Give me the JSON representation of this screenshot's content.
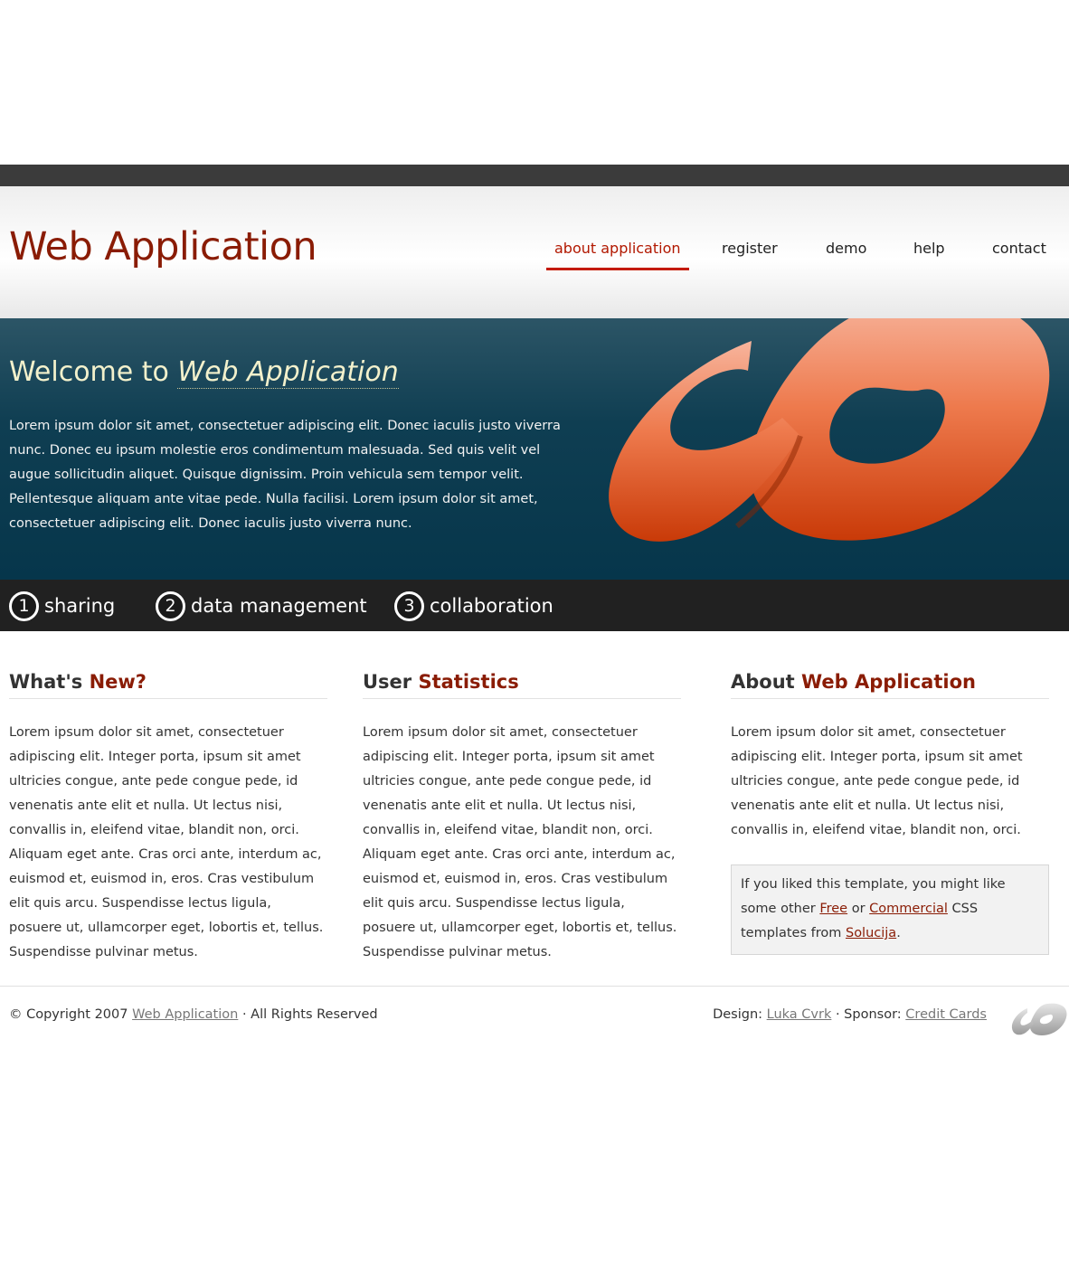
{
  "header": {
    "site_title": "Web Application",
    "nav": [
      {
        "label": "about application",
        "active": true
      },
      {
        "label": "register",
        "active": false
      },
      {
        "label": "demo",
        "active": false
      },
      {
        "label": "help",
        "active": false
      },
      {
        "label": "contact",
        "active": false
      }
    ]
  },
  "hero": {
    "title_prefix": "Welcome to ",
    "title_emphasis": "Web Application",
    "text": "Lorem ipsum dolor sit amet, consectetuer adipiscing elit. Donec iaculis justo viverra nunc. Donec eu ipsum molestie eros condimentum malesuada. Sed quis velit vel augue sollicitudin aliquet. Quisque dignissim. Proin vehicula sem tempor velit. Pellentesque aliquam ante vitae pede. Nulla facilisi. Lorem ipsum dolor sit amet, consectetuer adipiscing elit. Donec iaculis justo viverra nunc."
  },
  "features": [
    {
      "number": "1",
      "label": "sharing"
    },
    {
      "number": "2",
      "label": "data management"
    },
    {
      "number": "3",
      "label": "collaboration"
    }
  ],
  "columns": [
    {
      "title_plain": "What's ",
      "title_accent": "New?",
      "text": "Lorem ipsum dolor sit amet, consectetuer adipiscing elit. Integer porta, ipsum sit amet ultricies congue, ante pede congue pede, id venenatis ante elit et nulla. Ut lectus nisi, convallis in, eleifend vitae, blandit non, orci. Aliquam eget ante. Cras orci ante, interdum ac, euismod et, euismod in, eros. Cras vestibulum elit quis arcu. Suspendisse lectus ligula, posuere ut, ullamcorper eget, lobortis et, tellus. Suspendisse pulvinar metus."
    },
    {
      "title_plain": "User ",
      "title_accent": "Statistics",
      "text": "Lorem ipsum dolor sit amet, consectetuer adipiscing elit. Integer porta, ipsum sit amet ultricies congue, ante pede congue pede, id venenatis ante elit et nulla. Ut lectus nisi, convallis in, eleifend vitae, blandit non, orci. Aliquam eget ante. Cras orci ante, interdum ac, euismod et, euismod in, eros. Cras vestibulum elit quis arcu. Suspendisse lectus ligula, posuere ut, ullamcorper eget, lobortis et, tellus. Suspendisse pulvinar metus."
    },
    {
      "title_plain": "About ",
      "title_accent": "Web Application",
      "text": "Lorem ipsum dolor sit amet, consectetuer adipiscing elit. Integer porta, ipsum sit amet ultricies congue, ante pede congue pede, id venenatis ante elit et nulla. Ut lectus nisi, convallis in, eleifend vitae, blandit non, orci."
    }
  ],
  "promo": {
    "text_before": "If you liked this template, you might like some other ",
    "link_free": "Free",
    "text_or": " or ",
    "link_commercial": "Commercial",
    "text_after": " CSS templates from ",
    "link_solucija": "Solucija",
    "text_end": "."
  },
  "footer": {
    "copyright_prefix": "© Copyright 2007 ",
    "copyright_link": "Web Application",
    "copyright_suffix": " · All Rights Reserved",
    "design_label": "Design: ",
    "design_link": "Luka Cvrk",
    "sponsor_label": " · Sponsor: ",
    "sponsor_link": "Credit Cards"
  },
  "colors": {
    "brand": "#8a1c05",
    "nav_active": "#c41a00",
    "hero_bg": "#0f3e52",
    "hero_title": "#f3f1cc",
    "features_bar": "#212121",
    "logo_orange": "#e8531f"
  }
}
